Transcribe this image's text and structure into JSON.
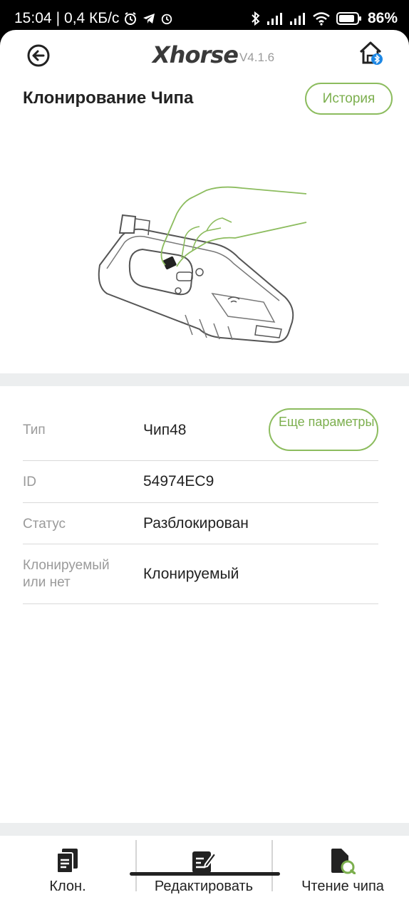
{
  "status_bar": {
    "time": "15:04",
    "separator": "|",
    "network_speed": "0,4 КБ/с",
    "battery": "86%"
  },
  "header": {
    "brand": "Xhorse",
    "version": "V4.1.6"
  },
  "page": {
    "title": "Клонирование Чипа",
    "history_label": "История"
  },
  "info": {
    "type": {
      "label": "Тип",
      "value": "Чип48"
    },
    "more_params_label": "Еще параметры",
    "id": {
      "label": "ID",
      "value": "54974EC9"
    },
    "status": {
      "label": "Статус",
      "value": "Разблокирован"
    },
    "clonable": {
      "label": "Клонируемый или нет",
      "value": "Клонируемый"
    }
  },
  "bottom_nav": {
    "items": [
      {
        "label": "Клон.",
        "icon": "clone-icon"
      },
      {
        "label": "Редактировать",
        "icon": "edit-icon"
      },
      {
        "label": "Чтение чипа",
        "icon": "read-chip-icon"
      }
    ]
  },
  "colors": {
    "accent": "#7caf4e",
    "band": "#eceeef"
  }
}
